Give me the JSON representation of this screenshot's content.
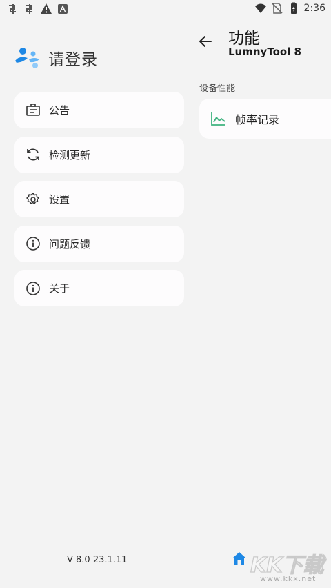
{
  "status_bar": {
    "time": "2:36",
    "left_icons": [
      "bug-icon",
      "bug-icon",
      "warning-icon",
      "notification-a-icon"
    ],
    "right_icons": [
      "wifi-icon",
      "no-sim-icon",
      "battery-charging-icon"
    ]
  },
  "drawer": {
    "title": "请登录",
    "avatar_icon": "people-icon",
    "items": [
      {
        "label": "公告",
        "icon": "announcement-icon"
      },
      {
        "label": "检测更新",
        "icon": "refresh-icon"
      },
      {
        "label": "设置",
        "icon": "gear-icon"
      },
      {
        "label": "问题反馈",
        "icon": "info-icon"
      },
      {
        "label": "关于",
        "icon": "info-icon"
      }
    ],
    "version": "V 8.0 23.1.11"
  },
  "panel": {
    "title": "功能",
    "subtitle": "LumnyTool 8",
    "section_label": "设备性能",
    "feature": {
      "label": "帧率记录",
      "icon": "chart-line-icon"
    },
    "bottom_icon": "home-icon"
  },
  "watermark": {
    "text": "KK下载",
    "url": "www.kkx.net"
  },
  "colors": {
    "background": "#f3f3f3",
    "card": "#fdfcfd",
    "accent_blue": "#1e88e5",
    "chart_green": "#3fb27f"
  }
}
